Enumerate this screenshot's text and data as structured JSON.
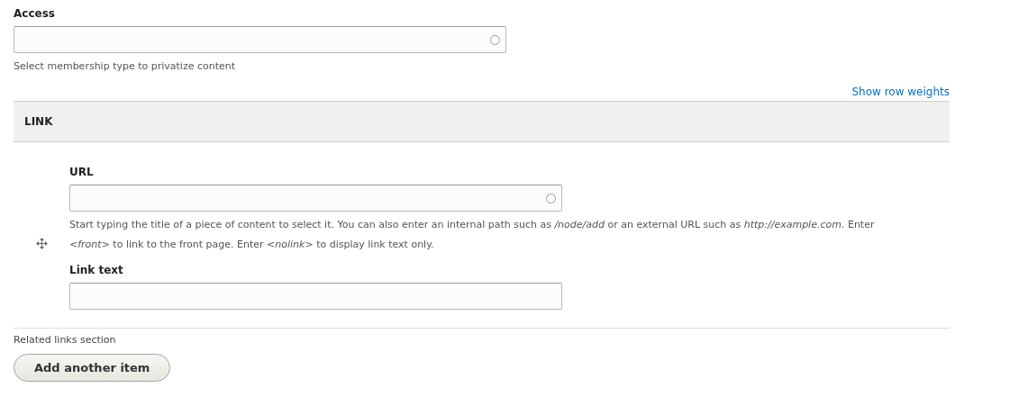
{
  "access": {
    "label": "Access",
    "autocomplete": true,
    "description": "Select membership type to privatize content"
  },
  "show_row_weights": "Show row weights",
  "table": {
    "header": "LINK",
    "rows": [
      {
        "draggable": true,
        "fields": [
          {
            "label": "URL",
            "autocomplete": true,
            "description": "Start typing the title of a piece of content to select it. You can also enter an internal path such as */node/add* or an external URL such as *http://example.com*. Enter *<front>* to link to the front page. Enter *<nolink>* to display link text only."
          },
          {
            "label": "Link text",
            "autocomplete": false
          }
        ]
      }
    ]
  },
  "section_description": "Related links section",
  "add_button": "Add another item"
}
